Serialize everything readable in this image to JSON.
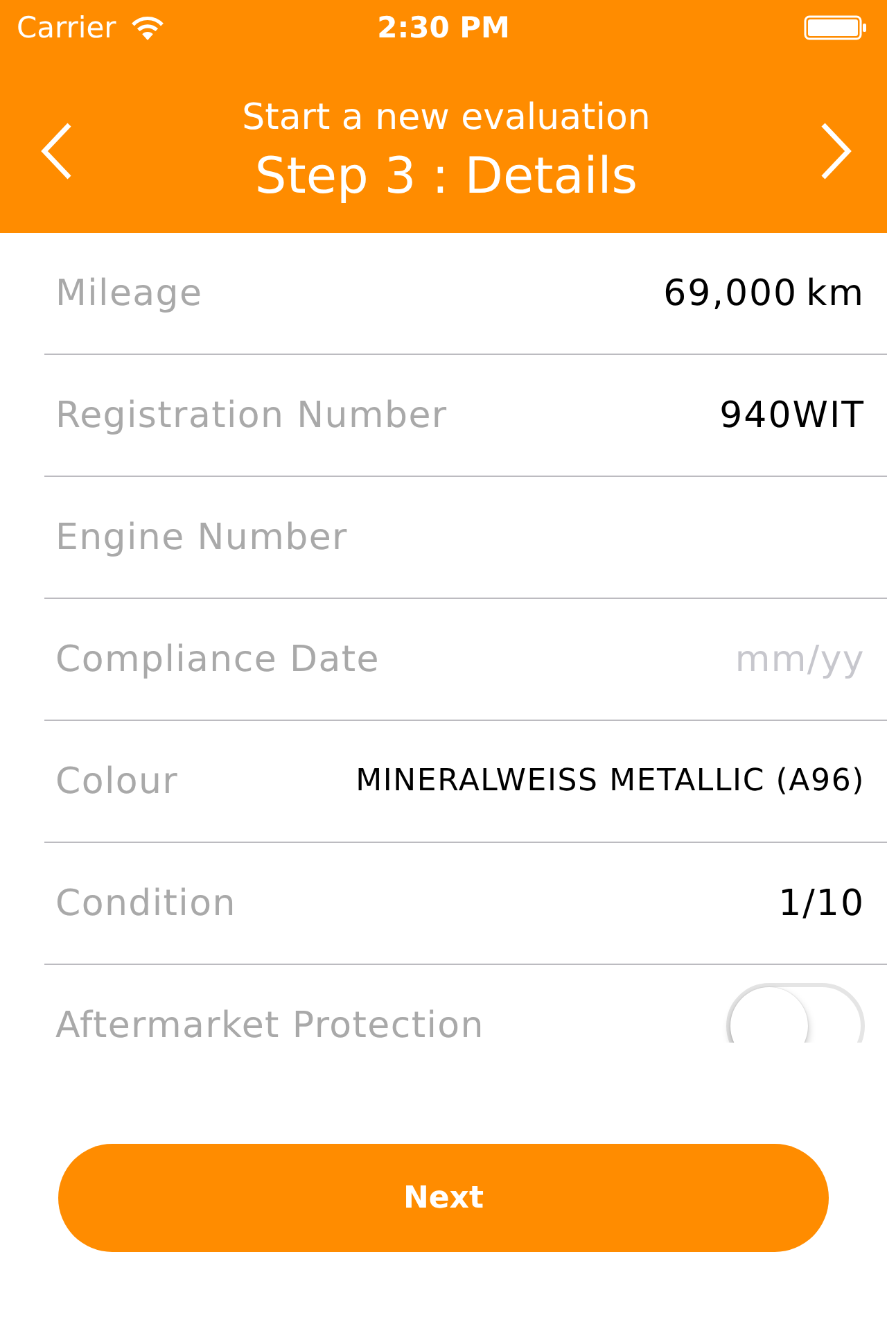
{
  "status_bar": {
    "carrier": "Carrier",
    "time": "2:30 PM"
  },
  "header": {
    "subtitle": "Start a new evaluation",
    "title": "Step 3 : Details"
  },
  "fields": [
    {
      "kind": "value",
      "label": "Mileage",
      "value": "69,000",
      "unit": "km"
    },
    {
      "kind": "value",
      "label": "Registration Number",
      "value": "940WIT"
    },
    {
      "kind": "input",
      "label": "Engine Number"
    },
    {
      "kind": "input",
      "label": "Compliance Date",
      "placeholder": "mm/yy"
    },
    {
      "kind": "caps",
      "label": "Colour",
      "value": "MINERALWEISS METALLIC (A96)"
    },
    {
      "kind": "value",
      "label": "Condition",
      "value": "1/10"
    },
    {
      "kind": "toggle",
      "label": "Aftermarket Protection",
      "on": false
    }
  ],
  "next_button": {
    "label": "Next"
  }
}
